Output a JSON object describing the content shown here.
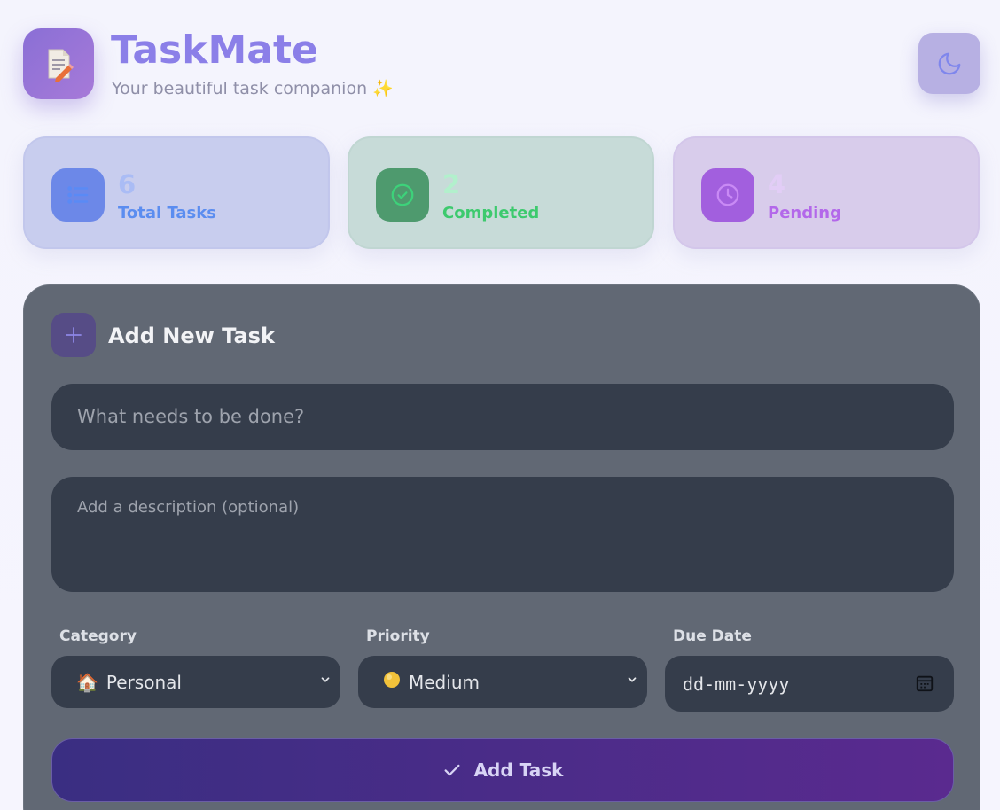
{
  "header": {
    "title": "TaskMate",
    "subtitle": "Your beautiful task companion ✨",
    "logo_icon": "memo-pencil-icon",
    "theme_toggle_icon": "moon-icon"
  },
  "stats": {
    "total": {
      "value": "6",
      "label": "Total Tasks",
      "icon": "list-icon"
    },
    "completed": {
      "value": "2",
      "label": "Completed",
      "icon": "check-circle-icon"
    },
    "pending": {
      "value": "4",
      "label": "Pending",
      "icon": "clock-icon"
    }
  },
  "form": {
    "title": "Add New Task",
    "task_placeholder": "What needs to be done?",
    "description_placeholder": "Add a description (optional)",
    "category": {
      "label": "Category",
      "emoji": "🏠",
      "value": "Personal"
    },
    "priority": {
      "label": "Priority",
      "emoji": "🟡",
      "value": "Medium"
    },
    "due_date": {
      "label": "Due Date",
      "placeholder": "dd-mm-yyyy"
    },
    "submit_label": "Add Task"
  },
  "colors": {
    "brand": "#8b7fe8",
    "panel": "#616874",
    "field": "#353d4b",
    "button_start": "#3a2e82",
    "button_end": "#5a2a8f"
  }
}
